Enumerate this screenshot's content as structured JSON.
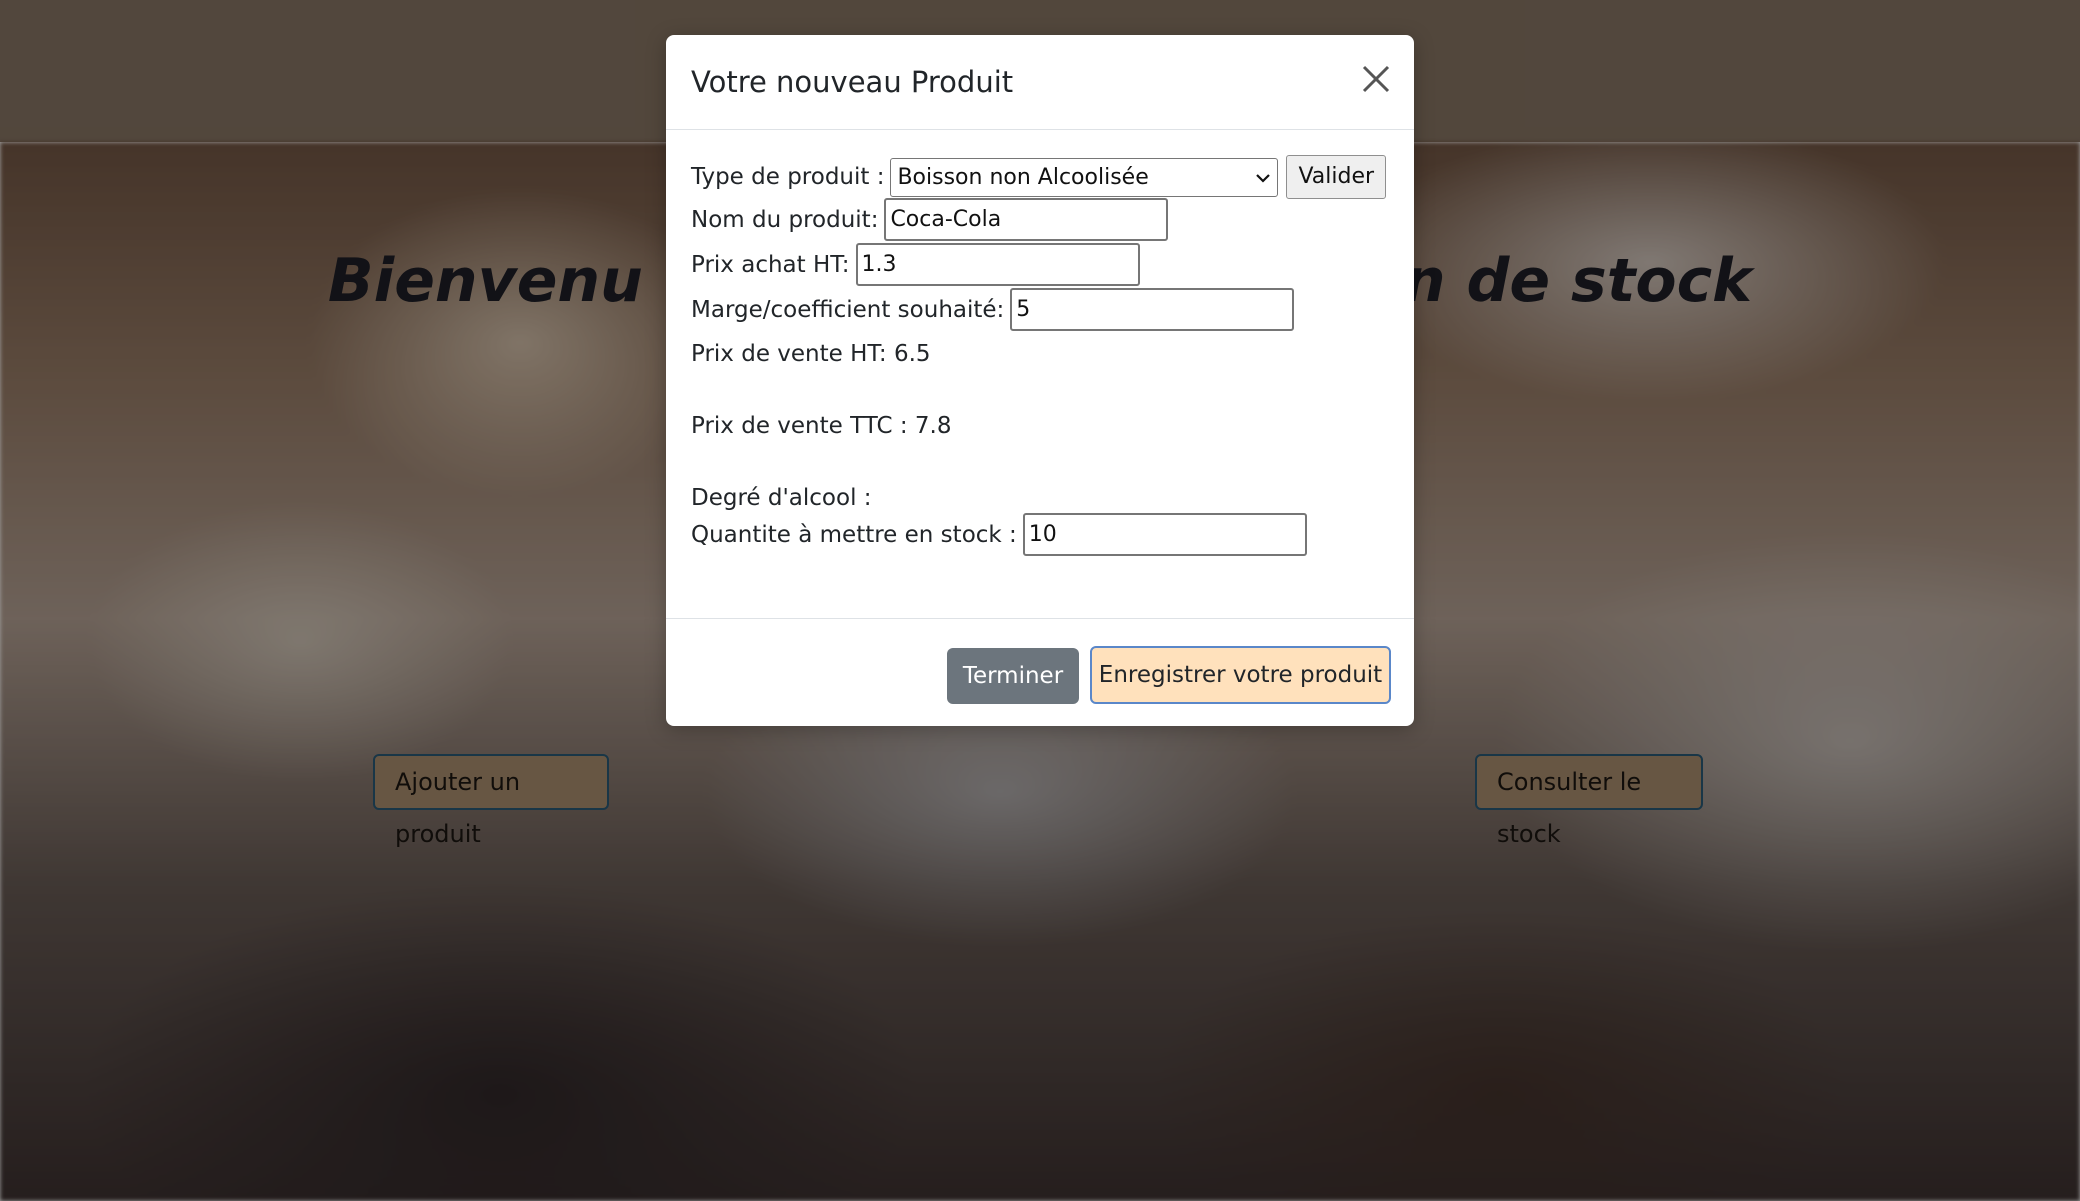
{
  "page": {
    "hero_left": "Bienvenu",
    "hero_right": "n de stock",
    "add_product_label": "Ajouter un produit",
    "stock_label": "Consulter le stock"
  },
  "modal": {
    "title": "Votre nouveau Produit",
    "close_icon": "close-icon",
    "type_label": "Type de produit :",
    "type_selected": "Boisson non Alcoolisée",
    "validate_label": "Valider",
    "name_label": "Nom du produit:",
    "name_value": "Coca-Cola",
    "purchase_label": "Prix achat HT:",
    "purchase_value": "1.3",
    "margin_label": "Marge/coefficient souhaité:",
    "margin_value": "5",
    "sale_ht": "Prix de vente HT: 6.5",
    "sale_ttc": "Prix de vente TTC : 7.8",
    "alcohol_label": "Degré d'alcool :",
    "quantity_label": "Quantite à mettre en stock :",
    "quantity_value": "10",
    "finish_label": "Terminer",
    "save_label": "Enregistrer votre produit"
  },
  "colors": {
    "top_band": "#7e6d5d",
    "secondary_button": "#6c757d",
    "save_button": "#ffe1bc",
    "save_border": "#5a87c9"
  }
}
